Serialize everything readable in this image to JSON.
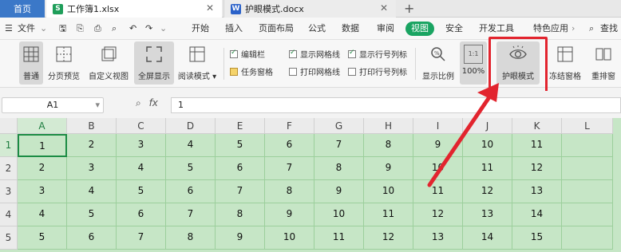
{
  "tabs": {
    "home": "首页",
    "active_file": "工作簿1.xlsx",
    "other_file": "护眼模式.docx",
    "new_tab": "+"
  },
  "menu": {
    "file": "文件",
    "items": [
      "开始",
      "插入",
      "页面布局",
      "公式",
      "数据",
      "审阅",
      "视图",
      "安全",
      "开发工具",
      "特色应用"
    ],
    "search": "查找"
  },
  "toolbar": {
    "normal": "普通",
    "page_break_preview": "分页预览",
    "custom_view": "自定义视图",
    "full_screen": "全屏显示",
    "reading_mode": "阅读模式",
    "edit_bar": "编辑栏",
    "task_pane": "任务窗格",
    "show_gridlines": "显示网格线",
    "print_gridlines": "打印网格线",
    "show_headers": "显示行号列标",
    "print_headers": "打印行号列标",
    "zoom_ratio": "显示比例",
    "zoom_100": "100%",
    "zoom_100_icon": "1:1",
    "eye_mode": "护眼模式",
    "freeze_panes": "冻结窗格",
    "rearrange": "重排窗"
  },
  "formula_bar": {
    "name_box": "A1",
    "fx": "fx",
    "value": "1"
  },
  "sheet": {
    "columns": [
      "A",
      "B",
      "C",
      "D",
      "E",
      "F",
      "G",
      "H",
      "I",
      "J",
      "K",
      "L"
    ],
    "rows": [
      "1",
      "2",
      "3",
      "4",
      "5"
    ],
    "cells": [
      [
        "1",
        "2",
        "3",
        "4",
        "5",
        "6",
        "7",
        "8",
        "9",
        "10",
        "11",
        ""
      ],
      [
        "2",
        "3",
        "4",
        "5",
        "6",
        "7",
        "8",
        "9",
        "10",
        "11",
        "12",
        ""
      ],
      [
        "3",
        "4",
        "5",
        "6",
        "7",
        "8",
        "9",
        "10",
        "11",
        "12",
        "13",
        ""
      ],
      [
        "4",
        "5",
        "6",
        "7",
        "8",
        "9",
        "10",
        "11",
        "12",
        "13",
        "14",
        ""
      ],
      [
        "5",
        "6",
        "7",
        "8",
        "9",
        "10",
        "11",
        "12",
        "13",
        "14",
        "15",
        ""
      ]
    ]
  },
  "colors": {
    "accent": "#1aa462",
    "eye_mode_bg": "#c6e6c6",
    "highlight": "#e2242e"
  }
}
